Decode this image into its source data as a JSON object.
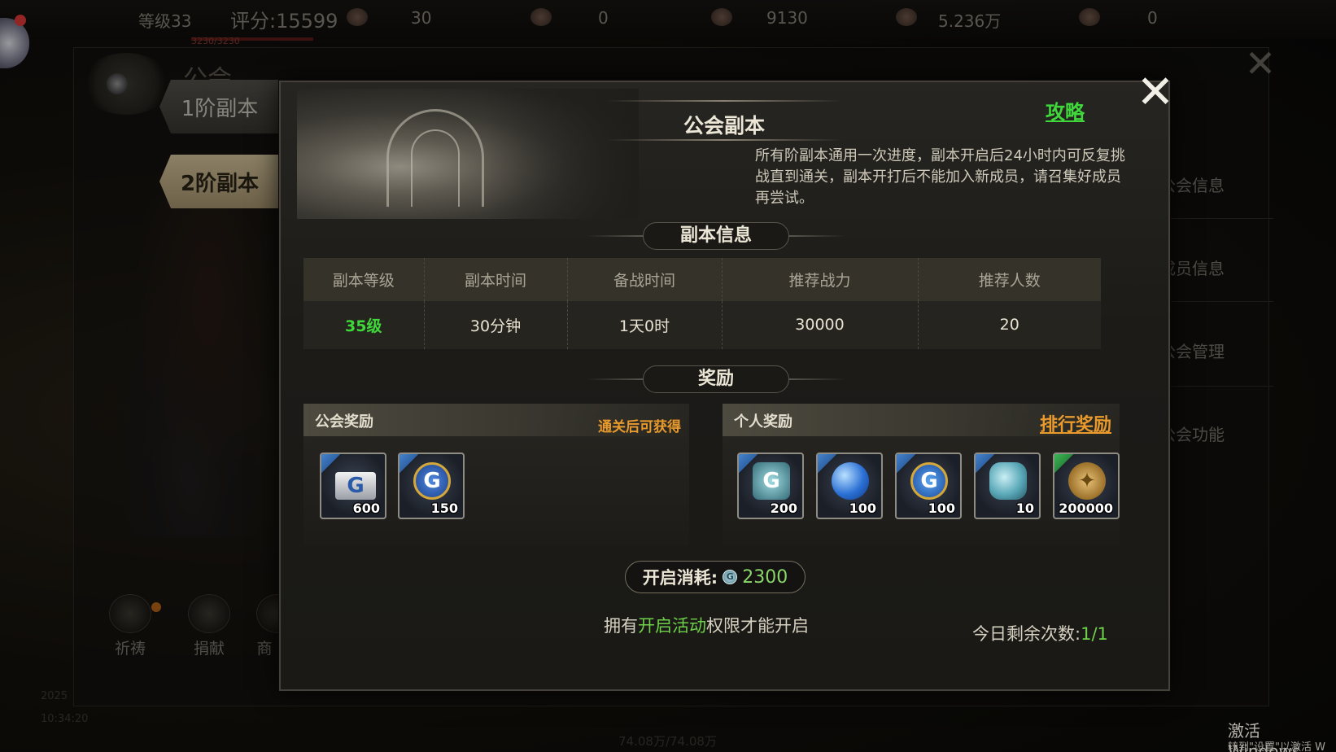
{
  "topbar": {
    "level": "等级33",
    "score": "评分:15599",
    "hp": "3230/3230",
    "res1": "30",
    "res2": "0",
    "res3": "9130",
    "res4": "5.236万",
    "res5": "0"
  },
  "background": {
    "panel_title": "公会",
    "right_menu": [
      "公会信息",
      "成员信息",
      "公会管理",
      "公会功能"
    ],
    "stage_tabs": [
      "1阶副本",
      "2阶副本"
    ],
    "bottom_buttons": [
      "祈祷",
      "捐献",
      "商"
    ],
    "footer_mid": "74.08万/74.08万",
    "footer_left": "2025",
    "footer_time": "10:34:20"
  },
  "dialog": {
    "title": "公会副本",
    "guide_link": "攻略",
    "description": "所有阶副本通用一次进度，副本开启后24小时内可反复挑战直到通关，副本开打后不能加入新成员，请召集好成员再尝试。",
    "info_section": "副本信息",
    "info_table": {
      "headers": [
        "副本等级",
        "副本时间",
        "备战时间",
        "推荐战力",
        "推荐人数"
      ],
      "values": [
        "35级",
        "30分钟",
        "1天0时",
        "30000",
        "20"
      ]
    },
    "reward_section": "奖励",
    "guild_reward": {
      "title": "公会奖励",
      "note": "通关后可获得",
      "items": [
        {
          "icon": "guild-flag-icon",
          "count": "600"
        },
        {
          "icon": "guild-medal-icon",
          "count": "150"
        }
      ]
    },
    "personal_reward": {
      "title": "个人奖励",
      "rank_link": "排行奖励",
      "items": [
        {
          "icon": "guild-gem-icon",
          "count": "200"
        },
        {
          "icon": "blue-orb-icon",
          "count": "100"
        },
        {
          "icon": "blue-coin-icon",
          "count": "100"
        },
        {
          "icon": "crystal-icon",
          "count": "10"
        },
        {
          "icon": "gold-coin-icon",
          "count": "200000"
        }
      ]
    },
    "cost": {
      "label": "开启消耗:",
      "icon_letter": "G",
      "value": "2300"
    },
    "permission": {
      "prefix": "拥有",
      "highlight": "开启活动",
      "suffix": "权限才能开启"
    },
    "remaining": {
      "label": "今日剩余次数:",
      "value": "1/1"
    }
  },
  "system": {
    "watermark_line1": "激活 Windows",
    "watermark_line2": "转到\"设置\"以激活 W"
  },
  "colors": {
    "accent_green": "#3fd83a",
    "accent_orange": "#e99a2d",
    "panel_bg": "#1c1b18"
  }
}
